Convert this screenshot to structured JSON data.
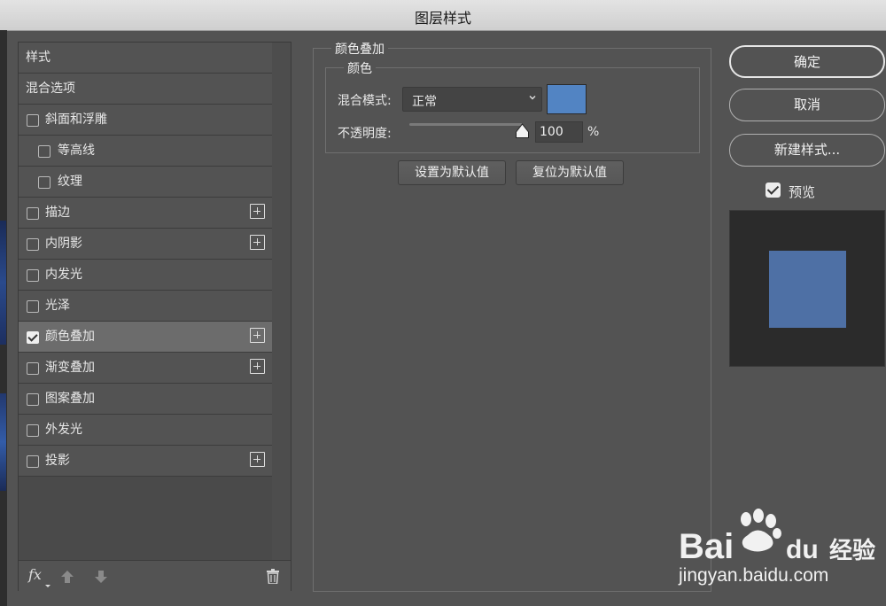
{
  "window": {
    "title": "图层样式"
  },
  "styles_list": {
    "items": [
      {
        "label": "样式",
        "checkbox": false,
        "checked": false,
        "plus": false,
        "indent": false,
        "selected": false
      },
      {
        "label": "混合选项",
        "checkbox": false,
        "checked": false,
        "plus": false,
        "indent": false,
        "selected": false
      },
      {
        "label": "斜面和浮雕",
        "checkbox": true,
        "checked": false,
        "plus": false,
        "indent": false,
        "selected": false
      },
      {
        "label": "等高线",
        "checkbox": true,
        "checked": false,
        "plus": false,
        "indent": true,
        "selected": false
      },
      {
        "label": "纹理",
        "checkbox": true,
        "checked": false,
        "plus": false,
        "indent": true,
        "selected": false
      },
      {
        "label": "描边",
        "checkbox": true,
        "checked": false,
        "plus": true,
        "indent": false,
        "selected": false
      },
      {
        "label": "内阴影",
        "checkbox": true,
        "checked": false,
        "plus": true,
        "indent": false,
        "selected": false
      },
      {
        "label": "内发光",
        "checkbox": true,
        "checked": false,
        "plus": false,
        "indent": false,
        "selected": false
      },
      {
        "label": "光泽",
        "checkbox": true,
        "checked": false,
        "plus": false,
        "indent": false,
        "selected": false
      },
      {
        "label": "颜色叠加",
        "checkbox": true,
        "checked": true,
        "plus": true,
        "indent": false,
        "selected": true
      },
      {
        "label": "渐变叠加",
        "checkbox": true,
        "checked": false,
        "plus": true,
        "indent": false,
        "selected": false
      },
      {
        "label": "图案叠加",
        "checkbox": true,
        "checked": false,
        "plus": false,
        "indent": false,
        "selected": false
      },
      {
        "label": "外发光",
        "checkbox": true,
        "checked": false,
        "plus": false,
        "indent": false,
        "selected": false
      },
      {
        "label": "投影",
        "checkbox": true,
        "checked": false,
        "plus": true,
        "indent": false,
        "selected": false
      }
    ],
    "footer": {
      "fx_label": "fx"
    }
  },
  "color_overlay": {
    "section_title": "颜色叠加",
    "group_title": "颜色",
    "blend_mode_label": "混合模式:",
    "blend_mode_value": "正常",
    "color": "#5284c3",
    "opacity_label": "不透明度:",
    "opacity_value": "100",
    "opacity_unit": "%",
    "opacity_fraction": 1.0,
    "set_default_label": "设置为默认值",
    "reset_default_label": "复位为默认值"
  },
  "actions": {
    "ok_label": "确定",
    "cancel_label": "取消",
    "new_style_label": "新建样式...",
    "preview_label": "预览",
    "preview_checked": true,
    "preview_color": "#4e70a5"
  },
  "watermark": {
    "brand_left": "Bai",
    "brand_right": "du",
    "brand_cn": "经验",
    "url": "jingyan.baidu.com"
  }
}
